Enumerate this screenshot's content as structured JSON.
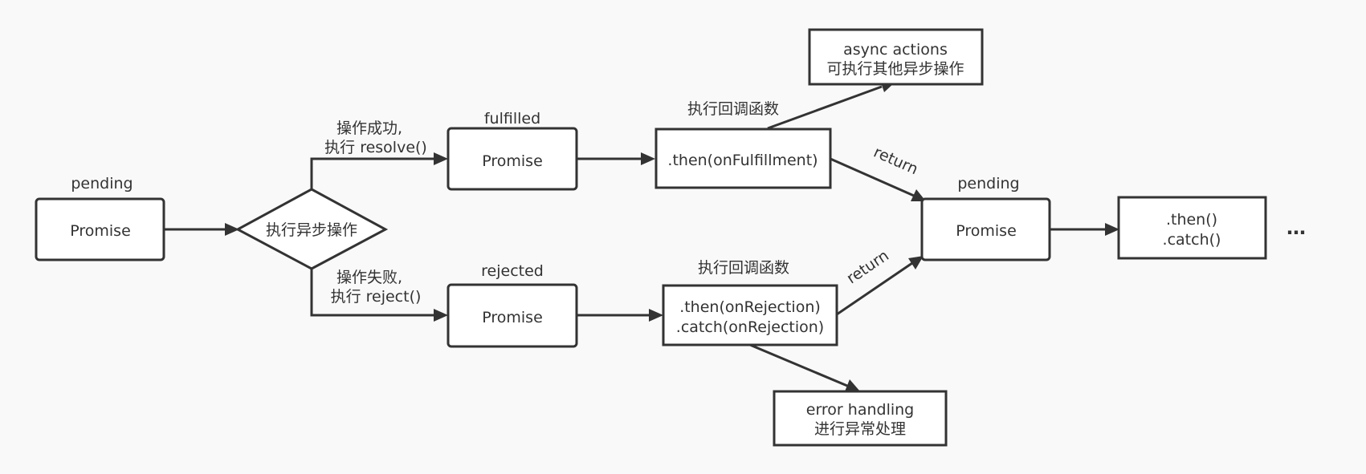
{
  "nodes": {
    "pending_state": "pending",
    "promise_initial": "Promise",
    "decision": "执行异步操作",
    "fulfilled_state": "fulfilled",
    "promise_fulfilled": "Promise",
    "rejected_state": "rejected",
    "promise_rejected": "Promise",
    "then_fulfillment": ".then(onFulfillment)",
    "then_rejection_line1": ".then(onRejection)",
    "then_rejection_line2": ".catch(onRejection)",
    "async_actions_line1": "async actions",
    "async_actions_line2": "可执行其他异步操作",
    "error_handling_line1": "error handling",
    "error_handling_line2": "进行异常处理",
    "pending_result_state": "pending",
    "promise_result": "Promise",
    "chain_line1": ".then()",
    "chain_line2": ".catch()",
    "ellipsis": "…"
  },
  "edges": {
    "success_line1": "操作成功,",
    "success_line2": "执行 resolve()",
    "failure_line1": "操作失败,",
    "failure_line2": "执行 reject()",
    "callback_top": "执行回调函数",
    "callback_bottom": "执行回调函数",
    "return_top": "return",
    "return_bottom": "return"
  },
  "colors": {
    "stroke": "#333333",
    "background": "#f9f9f9",
    "box_fill": "#ffffff"
  }
}
